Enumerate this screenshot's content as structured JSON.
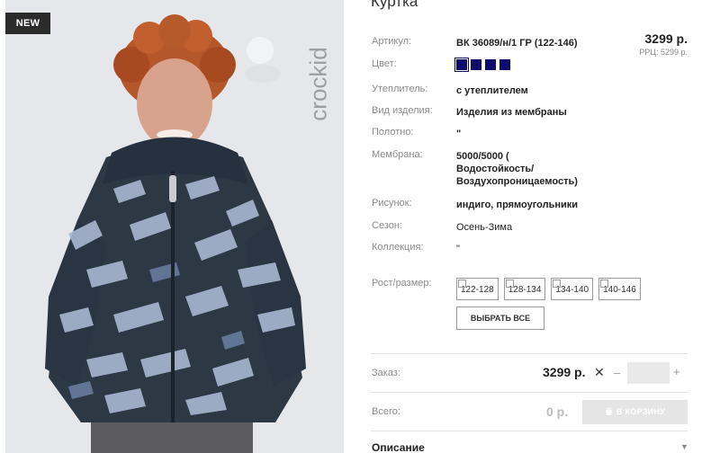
{
  "product": {
    "badge": "NEW",
    "brand": "crockid",
    "title": "Куртка",
    "price": "3299 р.",
    "rrc": "РРЦ: 5299 р."
  },
  "attributes": {
    "article": {
      "label": "Артикул:",
      "value": "ВК 36089/н/1 ГР (122-146)"
    },
    "color": {
      "label": "Цвет:",
      "swatch_color": "#0d0c6a"
    },
    "insulation": {
      "label": "Утеплитель:",
      "value": "с утеплителем"
    },
    "kind": {
      "label": "Вид изделия:",
      "value": "Изделия из мембраны"
    },
    "fabric": {
      "label": "Полотно:",
      "value": "\""
    },
    "membrane": {
      "label": "Мембрана:",
      "value_line1": "5000/5000 (",
      "value_line2": "Водостойкость/",
      "value_line3": "Воздухопроницаемость)"
    },
    "pattern": {
      "label": "Рисунок:",
      "value": "индиго, прямоугольники"
    },
    "season": {
      "label": "Сезон:",
      "value": "Осень-Зима"
    },
    "collection": {
      "label": "Коллекция:",
      "value": "\""
    }
  },
  "sizes": {
    "label": "Рост/размер:",
    "options": [
      "122-128",
      "128-134",
      "134-140",
      "140-146"
    ],
    "select_all": "ВЫБРАТЬ ВСЕ"
  },
  "order": {
    "label": "Заказ:",
    "price": "3299 р.",
    "minus": "–",
    "plus": "+",
    "quantity": ""
  },
  "total": {
    "label": "Всего:",
    "value": "0 р.",
    "cart_button": "В КОРЗИНУ"
  },
  "description": {
    "label": "Описание"
  },
  "colors": {
    "accent": "#0d0c6a",
    "badge_bg": "#2b2b2b",
    "disabled_button": "#e5e5e5"
  }
}
